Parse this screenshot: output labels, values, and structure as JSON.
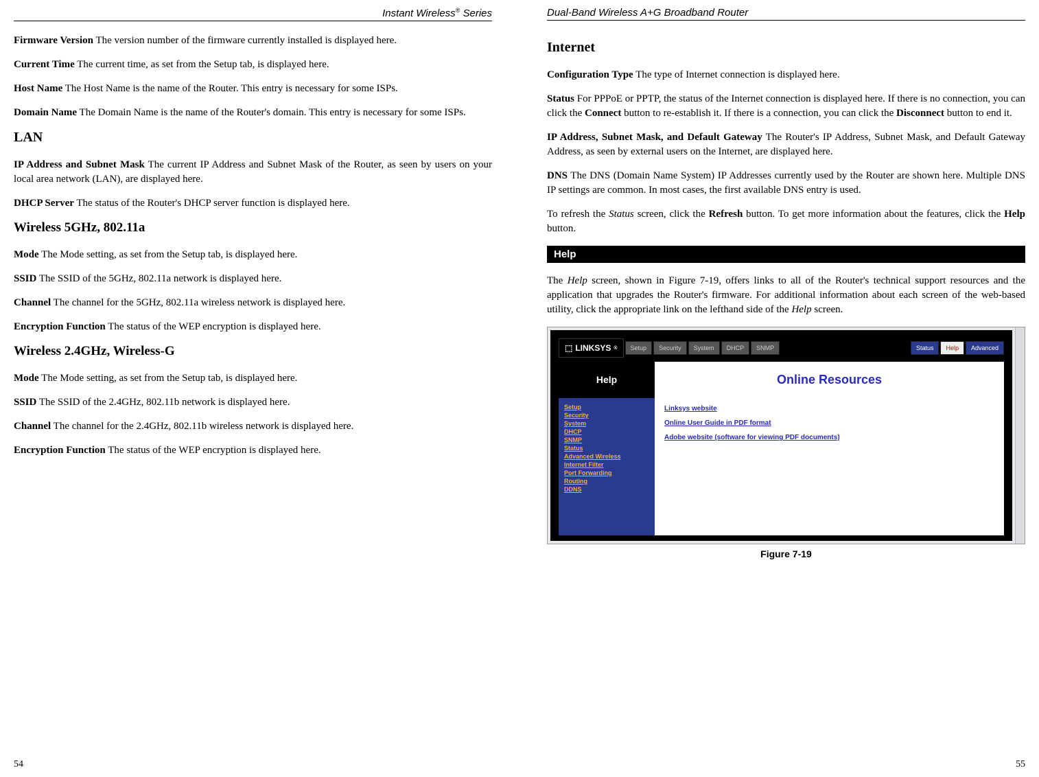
{
  "left": {
    "header_prefix": "Instant Wireless",
    "header_suffix": " Series",
    "fw_term": "Firmware Version",
    "fw_text": "  The version number of the firmware currently installed is displayed here.",
    "ct_term": "Current Time",
    "ct_text": "  The current time, as set from the Setup tab, is displayed here.",
    "hn_term": "Host Name",
    "hn_text": "  The Host Name is the name of the Router. This entry is necessary for some ISPs.",
    "dn_term": "Domain Name",
    "dn_text": "  The Domain Name is the name of the Router's domain. This entry is necessary for some ISPs.",
    "lan_heading": "LAN",
    "ip_term": "IP Address and Subnet Mask",
    "ip_text": "  The current IP Address and Subnet Mask of the Router, as seen by users on your local area network (LAN), are displayed here.",
    "dhcp_term": "DHCP Server",
    "dhcp_text": "  The status of the Router's DHCP server function is displayed here.",
    "w5_heading": "Wireless 5GHz, 802.11a",
    "w5_mode_term": "Mode",
    "w5_mode_text": "  The Mode setting, as set from the Setup tab, is displayed here.",
    "w5_ssid_term": "SSID",
    "w5_ssid_text": "  The SSID of the 5GHz, 802.11a network is displayed here.",
    "w5_ch_term": "Channel",
    "w5_ch_text": "  The channel for the 5GHz, 802.11a wireless network is displayed here.",
    "w5_enc_term": "Encryption Function",
    "w5_enc_text": "  The status of the WEP encryption is displayed here.",
    "w24_heading": "Wireless 2.4GHz, Wireless-G",
    "w24_mode_term": "Mode",
    "w24_mode_text": "  The Mode setting, as set from the Setup tab, is displayed here.",
    "w24_ssid_term": "SSID",
    "w24_ssid_text": "  The SSID of the 2.4GHz, 802.11b network is displayed here.",
    "w24_ch_term": "Channel",
    "w24_ch_text": "  The channel for the 2.4GHz, 802.11b wireless network is displayed here.",
    "w24_enc_term": "Encryption Function",
    "w24_enc_text": "  The status of the WEP encryption is displayed here.",
    "page_no": "54"
  },
  "right": {
    "header": "Dual-Band Wireless A+G Broadband Router",
    "internet_heading": "Internet",
    "cfg_term": "Configuration Type",
    "cfg_text": "  The type of Internet connection is displayed here.",
    "status_term": "Status",
    "status_text_a": "  For PPPoE or PPTP, the status of the Internet connection is displayed here. If there is no connection, you can click the ",
    "status_connect": "Connect",
    "status_text_b": " button to re-establish it. If there is a connection, you can click the ",
    "status_disconnect": "Disconnect",
    "status_text_c": " button to end it.",
    "ipsg_term": "IP Address, Subnet Mask, and Default Gateway",
    "ipsg_text": "  The Router's IP Address, Subnet Mask, and Default Gateway Address, as seen by external users on the Internet, are displayed here.",
    "dns_term": "DNS",
    "dns_text": "  The DNS (Domain Name System) IP Addresses currently used by the Router are shown here. Multiple DNS IP settings are common. In most cases, the first available DNS entry is used.",
    "refresh_a": "To refresh the ",
    "refresh_status": "Status",
    "refresh_b": " screen, click the ",
    "refresh_btn": "Refresh",
    "refresh_c": " button. To get more information about the features, click the ",
    "refresh_help": "Help",
    "refresh_d": " button.",
    "help_bar": "Help",
    "help_para_a": "The ",
    "help_para_help1": "Help",
    "help_para_b": " screen, shown in Figure 7-19, offers links to all of the Router's technical support resources and the application that upgrades the Router's firmware. For additional information about each screen of the web-based utility, click the appropriate link on the lefthand side of the ",
    "help_para_help2": "Help",
    "help_para_c": " screen.",
    "figure_caption": "Figure 7-19",
    "page_no": "55"
  },
  "router": {
    "logo": "LINKSYS",
    "tabs": [
      "Setup",
      "Security",
      "System",
      "DHCP",
      "SNMP"
    ],
    "right_tabs": [
      "Status",
      "Help",
      "Advanced"
    ],
    "help_label": "Help",
    "online_resources": "Online Resources",
    "nav": [
      "Setup",
      "Security",
      "System",
      "DHCP",
      "SNMP",
      "Status",
      "Advanced Wireless",
      "Internet Filter",
      "Port Forwarding",
      "Routing",
      "DDNS"
    ],
    "links": [
      "Linksys website",
      "Online User Guide in PDF format",
      "Adobe website (software for viewing PDF documents)"
    ]
  }
}
